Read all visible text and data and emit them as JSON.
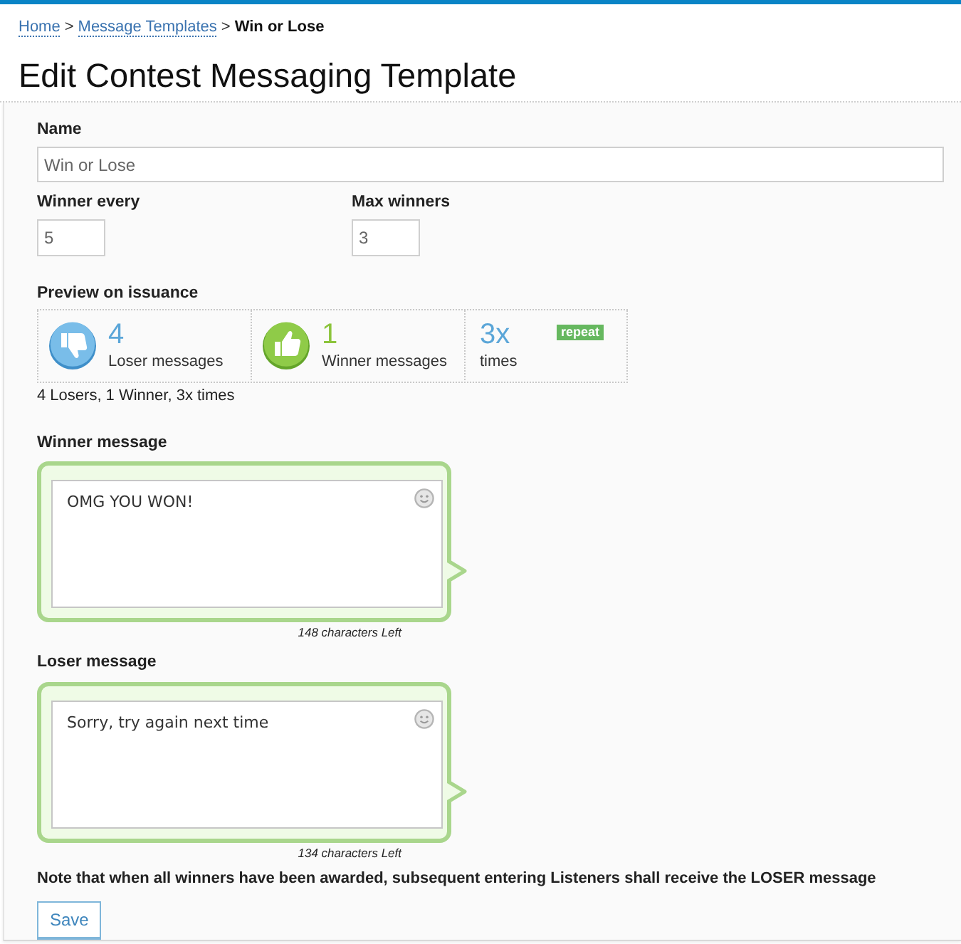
{
  "breadcrumb": {
    "separator": ">",
    "items": [
      {
        "label": "Home",
        "kind": "link"
      },
      {
        "label": "Message Templates",
        "kind": "link"
      },
      {
        "label": "Win or Lose",
        "kind": "current"
      }
    ]
  },
  "page_title": "Edit Contest Messaging Template",
  "form": {
    "name": {
      "label": "Name",
      "value": "Win or Lose"
    },
    "winner_every": {
      "label": "Winner every",
      "value": "5"
    },
    "max_winners": {
      "label": "Max winners",
      "value": "3"
    },
    "preview": {
      "label": "Preview on issuance",
      "cells": [
        {
          "kind": "loser",
          "count": "4",
          "caption": "Loser messages"
        },
        {
          "kind": "winner",
          "count": "1",
          "caption": "Winner messages"
        },
        {
          "kind": "repeat",
          "count": "3x",
          "caption": "times",
          "badge": "repeat"
        }
      ],
      "summary": "4 Losers, 1 Winner, 3x times"
    },
    "messages": [
      {
        "label": "Winner message",
        "value": "OMG YOU WON!",
        "counter": "148 characters Left"
      },
      {
        "label": "Loser message",
        "value": "Sorry, try again next time",
        "counter": "134 characters Left"
      }
    ],
    "note": "Note that when all winners have been awarded, subsequent entering Listeners shall receive the LOSER message",
    "save_button": "Save"
  }
}
